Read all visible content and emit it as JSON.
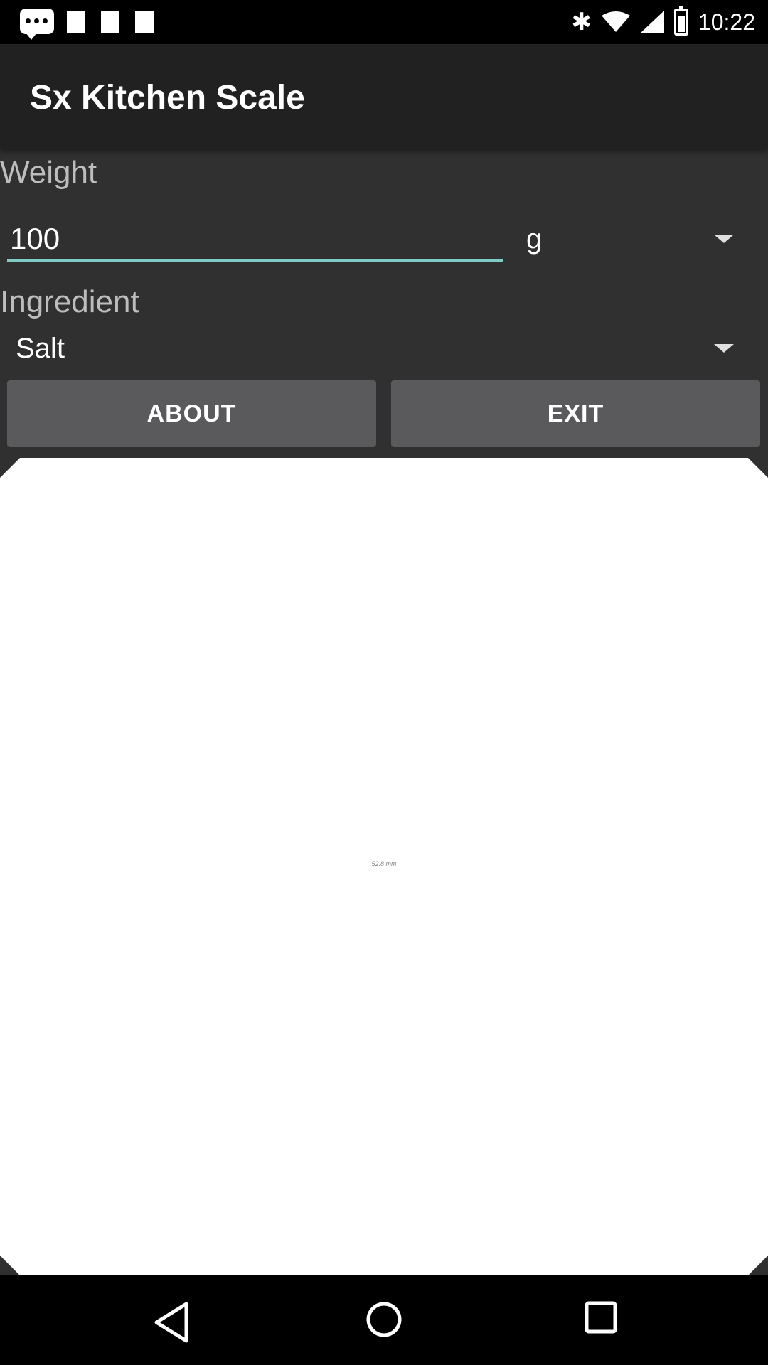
{
  "status_bar": {
    "time": "10:22",
    "icons": [
      "message-icon",
      "notification-icon",
      "notification-icon",
      "notification-icon",
      "bluetooth-icon",
      "wifi-icon",
      "signal-icon",
      "battery-icon"
    ],
    "bluetooth_glyph": "✱"
  },
  "app": {
    "title": "Sx Kitchen Scale"
  },
  "weight": {
    "label": "Weight",
    "value": "100",
    "unit": "g"
  },
  "ingredient": {
    "label": "Ingredient",
    "selected": "Salt"
  },
  "buttons": {
    "about": "ABOUT",
    "exit": "EXIT"
  },
  "scale": {
    "measure_text": "52.8 mm"
  },
  "nav": {
    "icons": [
      "back-icon",
      "home-icon",
      "recents-icon"
    ]
  },
  "colors": {
    "accent": "#80cbc4",
    "toolbar": "#212121",
    "background": "#303030",
    "button": "#5a5a5c"
  }
}
